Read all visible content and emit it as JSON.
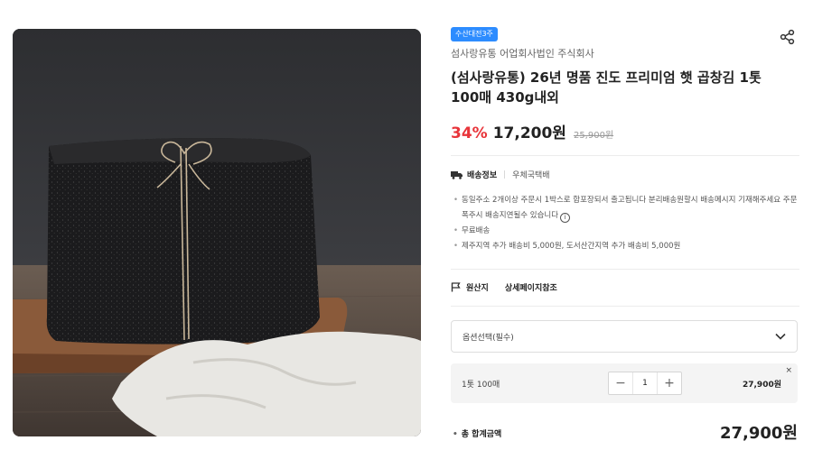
{
  "product": {
    "badge": "수산대전3주",
    "seller": "섬사랑유통 어업회사법인 주식회사",
    "title": "(섬사랑유통) 26년 명품 진도 프리미엄 햇 곱창김 1톳 100매 430g내외",
    "discount": "34%",
    "price": "17,200원",
    "original_price": "25,900원",
    "image_icon": "seaweed-bundle-photo"
  },
  "shipping": {
    "label": "배송정보",
    "method": "우체국택배",
    "notes": [
      "동일주소 2개이상 주문시 1박스로 합포장되서 출고됩니다 분리배송원할시 배송메시지 기재해주세요 주문폭주시 배송지연될수 있습니다",
      "무료배송",
      "제주지역 추가 배송비 5,000원, 도서산간지역 추가 배송비 5,000원"
    ]
  },
  "origin": {
    "label": "원산지",
    "value": "상세페이지참조"
  },
  "option_select": {
    "placeholder": "옵션선택(필수)"
  },
  "selected_option": {
    "name": "1톳 100매",
    "quantity": "1",
    "price": "27,900원",
    "minus": "−",
    "plus": "+",
    "remove": "×"
  },
  "total": {
    "label": "총 합계금액",
    "price": "27,900원"
  },
  "colors": {
    "accent_discount": "#e8343a",
    "badge_blue": "#2d8cff"
  }
}
